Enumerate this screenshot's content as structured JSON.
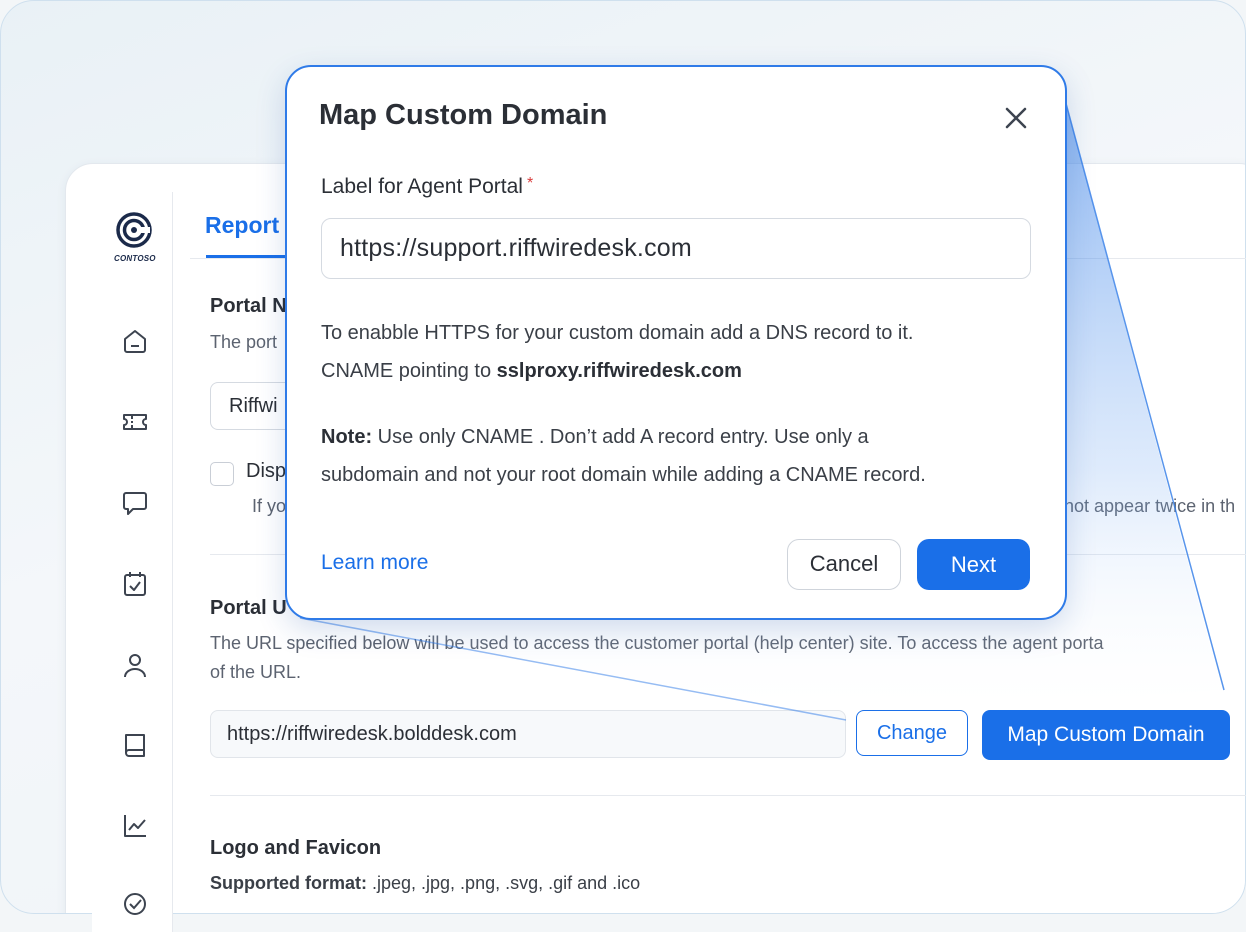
{
  "brand": {
    "logo_text": "CONTOSO",
    "accent": "#1a6fe8"
  },
  "sidebar": {
    "icons": [
      "home-icon",
      "ticket-icon",
      "chat-icon",
      "calendar-check-icon",
      "user-icon",
      "book-icon",
      "chart-icon",
      "check-circle-icon"
    ]
  },
  "tabs": {
    "active_label": "Report"
  },
  "portal_name": {
    "title": "Portal N",
    "desc": "The port",
    "input_value": "Riffwi",
    "checkbox_label": "Disp",
    "hint_left": "If yo",
    "hint_right": "not appear twice in th"
  },
  "portal_url": {
    "title": "Portal U",
    "desc_line1": "The URL specified below will be used to access the customer portal (help center) site. To access the agent porta",
    "desc_line2": "of the URL.",
    "url_value": "https://riffwiredesk.bolddesk.com",
    "change_label": "Change",
    "map_label": "Map Custom Domain"
  },
  "logo_section": {
    "title": "Logo and Favicon",
    "formats_label": "Supported format:",
    "formats_value": " .jpeg, .jpg, .png, .svg, .gif and .ico"
  },
  "modal": {
    "title": "Map Custom Domain",
    "field_label": "Label for Agent Portal",
    "required_mark": "*",
    "input_value": "https://support.riffwiredesk.com",
    "https_line1": "To enabble HTTPS for your custom domain add a DNS record to it.",
    "https_line2_prefix": "CNAME pointing to ",
    "https_line2_bold": "sslproxy.riffwiredesk.com",
    "note_label": "Note:",
    "note_line1": " Use only CNAME . Don’t add A record entry. Use only a",
    "note_line2": "subdomain and not your root domain while adding a CNAME record.",
    "learn_more": "Learn more",
    "cancel_label": "Cancel",
    "next_label": "Next"
  }
}
